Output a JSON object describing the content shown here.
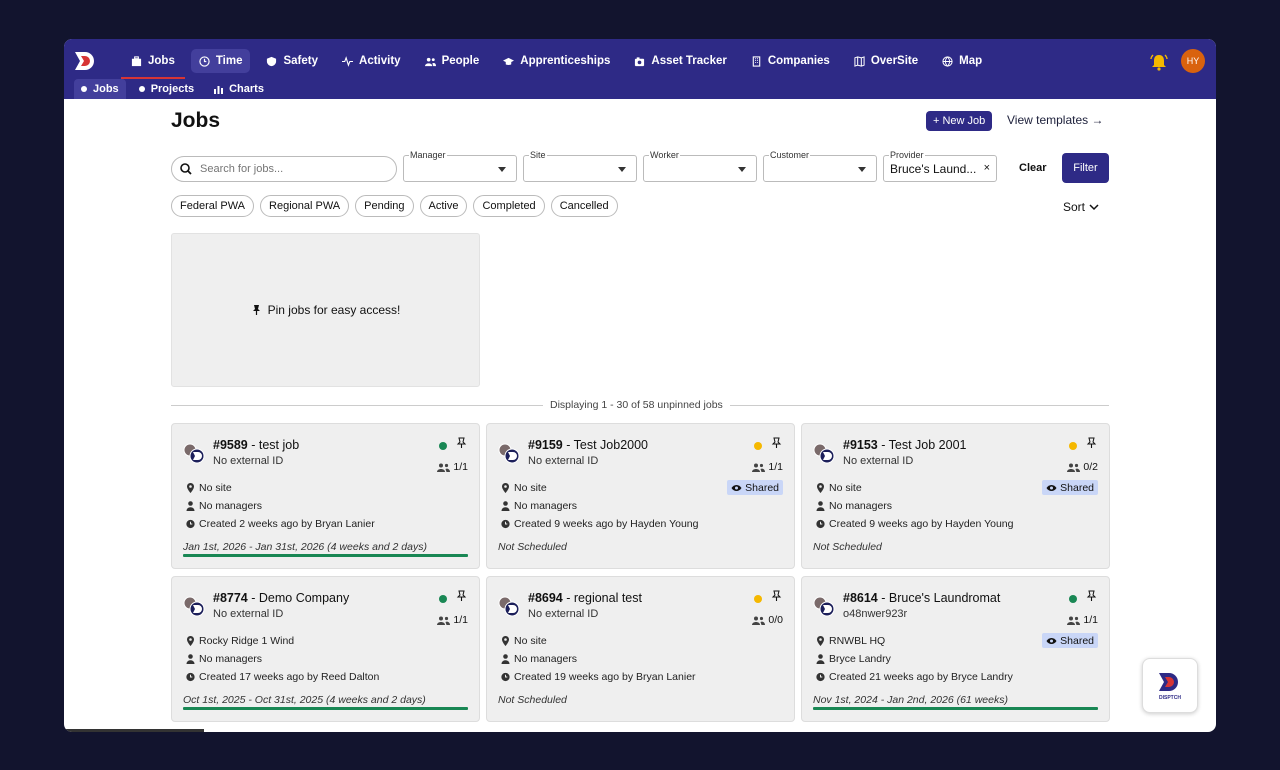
{
  "nav": {
    "items": [
      {
        "label": "Jobs",
        "icon": "briefcase-icon"
      },
      {
        "label": "Time",
        "icon": "clock-icon"
      },
      {
        "label": "Safety",
        "icon": "shield-icon"
      },
      {
        "label": "Activity",
        "icon": "pulse-icon"
      },
      {
        "label": "People",
        "icon": "people-icon"
      },
      {
        "label": "Apprenticeships",
        "icon": "graduation-cap-icon"
      },
      {
        "label": "Asset Tracker",
        "icon": "camera-icon"
      },
      {
        "label": "Companies",
        "icon": "building-icon"
      },
      {
        "label": "OverSite",
        "icon": "map-book-icon"
      },
      {
        "label": "Map",
        "icon": "globe-icon"
      }
    ],
    "avatar_initials": "HY",
    "accent": "#2e2a86"
  },
  "subnav": {
    "items": [
      {
        "label": "Jobs"
      },
      {
        "label": "Projects"
      },
      {
        "label": "Charts"
      }
    ]
  },
  "page": {
    "title": "Jobs",
    "new_job_label": "+ New Job",
    "view_templates_label": "View templates →"
  },
  "filters": {
    "search_placeholder": "Search for jobs...",
    "manager_label": "Manager",
    "site_label": "Site",
    "worker_label": "Worker",
    "customer_label": "Customer",
    "provider_label": "Provider",
    "provider_value": "Bruce's Laund...",
    "clear_label": "Clear",
    "filter_label": "Filter",
    "chips": [
      "Federal PWA",
      "Regional PWA",
      "Pending",
      "Active",
      "Completed",
      "Cancelled"
    ],
    "sort_label": "Sort"
  },
  "pinned": {
    "empty_text": "Pin jobs for easy access!"
  },
  "listing": {
    "display_text": "Displaying 1 - 30 of 58 unpinned jobs"
  },
  "jobs": [
    {
      "number": "#9589",
      "name": " - test job",
      "external": "No external ID",
      "status_color": "#198754",
      "count": "1/1",
      "site": "No site",
      "managers": "No managers",
      "created": "Created 2 weeks ago by Bryan Lanier",
      "dates": "Jan 1st, 2026 - Jan 31st, 2026 (4 weeks and 2 days)",
      "shared": "",
      "progress": 1
    },
    {
      "number": "#9159",
      "name": " - Test Job2000",
      "external": "No external ID",
      "status_color": "#f5b800",
      "count": "1/1",
      "site": "No site",
      "managers": "No managers",
      "created": "Created 9 weeks ago by Hayden Young",
      "dates": "Not Scheduled",
      "shared": "Shared",
      "progress": 0
    },
    {
      "number": "#9153",
      "name": " - Test Job 2001",
      "external": "No external ID",
      "status_color": "#f5b800",
      "count": "0/2",
      "site": "No site",
      "managers": "No managers",
      "created": "Created 9 weeks ago by Hayden Young",
      "dates": "Not Scheduled",
      "shared": "Shared",
      "progress": 0
    },
    {
      "number": "#8774",
      "name": " - Demo Company",
      "external": "No external ID",
      "status_color": "#198754",
      "count": "1/1",
      "site": "Rocky Ridge 1 Wind",
      "managers": "No managers",
      "created": "Created 17 weeks ago by Reed Dalton",
      "dates": "Oct 1st, 2025 - Oct 31st, 2025 (4 weeks and 2 days)",
      "shared": "",
      "progress": 1
    },
    {
      "number": "#8694",
      "name": " - regional test",
      "external": "No external ID",
      "status_color": "#f5b800",
      "count": "0/0",
      "site": "No site",
      "managers": "No managers",
      "created": "Created 19 weeks ago by Bryan Lanier",
      "dates": "Not Scheduled",
      "shared": "",
      "progress": 0
    },
    {
      "number": "#8614",
      "name": " - Bruce's Laundromat",
      "external": "o48nwer923r",
      "status_color": "#198754",
      "count": "1/1",
      "site": "RNWBL HQ",
      "managers": "Bryce Landry",
      "created": "Created 21 weeks ago by Bryce Landry",
      "dates": "Nov 1st, 2024 - Jan 2nd, 2026 (61 weeks)",
      "shared": "Shared",
      "progress": 1
    }
  ],
  "fab": {
    "label": "DISPTCH"
  }
}
